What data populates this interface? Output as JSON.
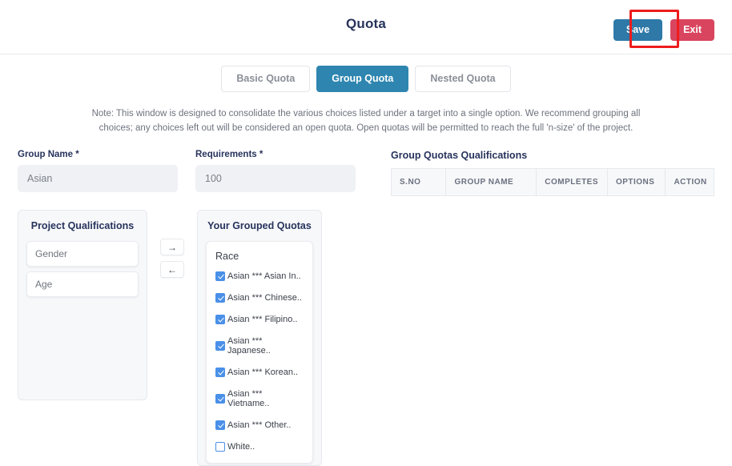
{
  "header": {
    "title": "Quota",
    "save_label": "Save",
    "exit_label": "Exit"
  },
  "tabs": [
    {
      "label": "Basic Quota",
      "active": false
    },
    {
      "label": "Group Quota",
      "active": true
    },
    {
      "label": "Nested Quota",
      "active": false
    }
  ],
  "note": "Note: This window is designed to consolidate the various choices listed under a target into a single option. We recommend grouping all choices; any choices left out will be considered an open quota. Open quotas will be permitted to reach the full 'n-size' of the project.",
  "form": {
    "group_name": {
      "label": "Group Name *",
      "value": "Asian",
      "placeholder": "Group Name"
    },
    "requirements": {
      "label": "Requirements *",
      "value": "100",
      "placeholder": "Requirements"
    }
  },
  "table": {
    "title": "Group Quotas Qualifications",
    "columns": [
      "S.NO",
      "GROUP NAME",
      "COMPLETES",
      "OPTIONS",
      "ACTION"
    ],
    "rows": []
  },
  "project_qualifications": {
    "title": "Project Qualifications",
    "items": [
      "Gender",
      "Age"
    ]
  },
  "transfer_buttons": {
    "move_right": "→",
    "move_left": "←"
  },
  "grouped_quotas": {
    "title": "Your Grouped Quotas",
    "card_title": "Race",
    "options": [
      {
        "label": "Asian *** Asian In..",
        "checked": true
      },
      {
        "label": "Asian *** Chinese..",
        "checked": true
      },
      {
        "label": "Asian *** Filipino..",
        "checked": true
      },
      {
        "label": "Asian *** Japanese..",
        "checked": true
      },
      {
        "label": "Asian *** Korean..",
        "checked": true
      },
      {
        "label": "Asian *** Vietname..",
        "checked": true
      },
      {
        "label": "Asian *** Other..",
        "checked": true
      },
      {
        "label": "White..",
        "checked": false
      }
    ]
  },
  "colors": {
    "accent_tab": "#2e86b0",
    "save": "#2e79a8",
    "exit": "#d9455f",
    "checkbox": "#4a90e8",
    "annotation": "#ee1c1c",
    "title": "#27335c"
  }
}
